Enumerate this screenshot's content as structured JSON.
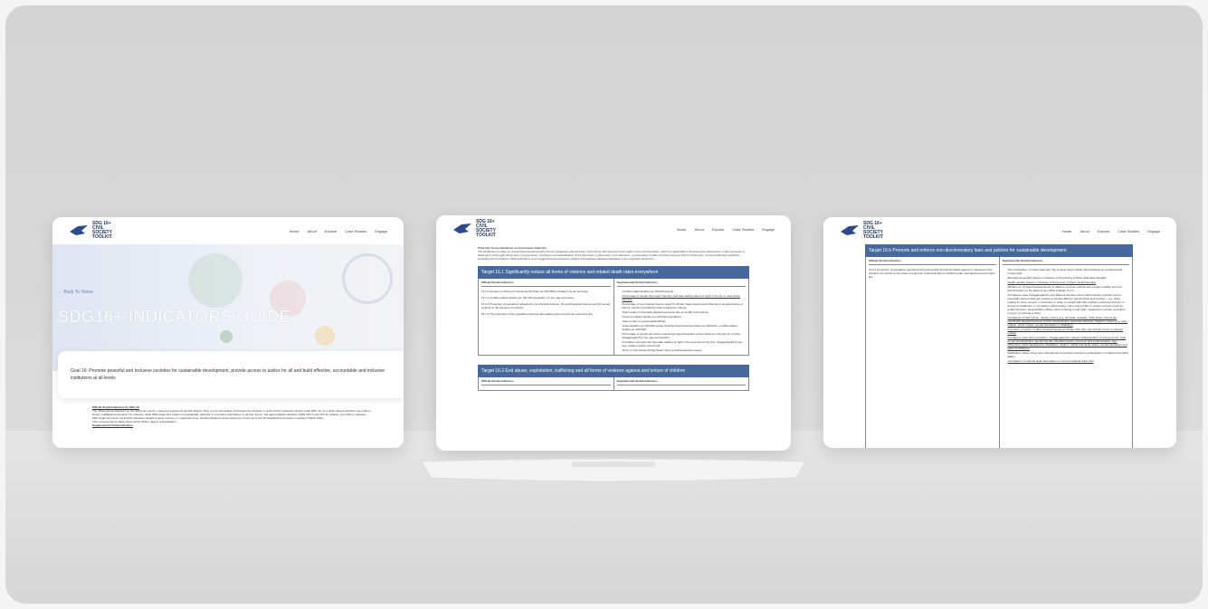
{
  "site": {
    "logo": "SDG 16+ CIVIL SOCIETY TOOLKIT",
    "menu": [
      "Home",
      "About",
      "Explore",
      "Case Studies",
      "Engage"
    ]
  },
  "screen1": {
    "back": "← Back To Home",
    "title": "SDG16+ INDICATORS GUIDE",
    "goal": "Goal 16: Promote peaceful and inclusive societies for sustainable development, provide access to justice for all and build effective, accountable and inclusive institutions at all levels",
    "section": "Official Global Indicators for SDG 16",
    "body": "The official global indicators for the SDGs are used to measure progress on specific targets. They do not necessarily encompass the full letter or spirit of their respective targets under SDG 16, as a given target's ambition may refer to broad, multifaceted concepts. For instance, while SDG target 16.1 refers to a sustainable reduction in corruption and bribery \"in all their forms\", the agreed global indicators (SDG 16.5.1 and 16.5.2) measure only bribery. Likewise, SDG target 16.4 does not include indicators related to asset recovery or organized crime. Global indicators shown below are current as of the UN Statistical Commission meeting in March 2021.",
    "note": "This correspondence table shows all the SDGs, targets and indicators.",
    "supp": "Supplemental Global Indicators"
  },
  "screen2": {
    "intro_title": "Praia City Group Handbook on Governance Statistics",
    "intro": "The Handbook provides an overarching framework with common analytical underpinnings, informed by international human rights norms and principles, which are applicable to all governance dimensions. It also examines in detail each of the eight dimensions of governance, including a conceptualization of the dimension, a discussion of its relevance, a presentation of data and best practices that currently exist, recommended key indicators (including but not limited to SDG indicators), and a suggested way forward to achieve international statistical standards in the respective dimension.",
    "t1_title": "Target 16.1 Significantly reduce all forms of violence and related death rates everywhere",
    "col_official": "Official Global Indicators",
    "col_supp": "Supplemental Global Indicators",
    "t1_official": [
      "16.1.1 Number of victims of intentional homicide per 100,000 population, by sex and age",
      "16.1.2 Conflict-related deaths per 100,000 population, by sex, age and cause",
      "16.1.3 Proportion of population subjected to (a) physical violence, (b) psychological violence and (c) sexual violence in the previous 12 months",
      "16.1.4 The proportion of the population that feel safe walking alone around the area they live"
    ],
    "t1_supp": [
      "Conflict-related deaths per 100,000 people",
      "Percentage of people who report that they feel safe walking alone at night in the city or area where they live",
      "Percentage of ever-married women aged 15-49 who have experienced physical or sexual violence in last 12 months committed by their husband or partner",
      "Total number of internally displaced persons due to conflict and violence",
      "Firearms related injuries per 100,000 populations",
      "Total number of extra-judicial killings",
      "Violent deaths per 100,000 people (includes intentional homicides per 100,000 + conflict-related deaths per 100,000)",
      "Percentage of people who have experienced physical and/or sexual violence in the last 12 months, disaggregated by sex, age and location",
      "Proportion of people who feel safe walking at night in the area where they live, disaggregated by sex, age, location and/or urban/rural",
      "Score on the annual Global Peace Index (positive/negative peace)"
    ],
    "t2_title": "Target 16.2 End abuse, exploitation, trafficking and all forms of violence against and torture of children"
  },
  "screen3": {
    "t_title": "Target 16.b Promote and enforce non-discriminatory laws and policies for sustainable development",
    "col_official": "Official Global Indicators",
    "col_supp": "Supplemental Global Indicators",
    "official": "16.b.1 Proportion of population reporting having personally felt discriminated against or harassed in the previous 12 months on the basis of a ground of discrimination prohibited under international human rights law",
    "supp": [
      "The Constitution, or other basic law, has a clause that prohibits discrimination as a fundamental human right",
      "Educational equality based on Varieties of Democracy (V-Dem) Education Equality",
      "Health equality based on Varieties of Democracy (V-Dem) Health Equality",
      "Whether or not legal frameworks are in place to promote, enforce and monitor equality and non-discrimination on the basis of sex (SDG indicator 5.1.1)",
      "Prevalence rates, disaggregated by the different domains where discrimination typically occurs, especially when people are seeking to access different opportunities and services – e.g. when looking for work, at work, in education or when in contact with their children's school personnel, in access to healthcare, in connection with housing, when using public or private services (such as public transport, administrative offices, when entering a night club, restaurant or a hotel, and when trying in or entering a shop)",
      "Prevalence of hate crimes, namely crimes (e.g. homicide, assaults, theft) where victims are specifically targeted because of their characteristics (ascribed attributes, beliefs or values (e.g. race, religion, ethnic origins, sexual orientation or disability))",
      "Proportion of victims of discrimination/harassment/hate crime who reported the crime to relevant entities",
      "Prevalence rates and proportions, disaggregated by relevant characteristics of groups at risk, such as sex characteristics, gender identity, education levels, economic and social situation, age, citizenship, ethnic background, disabilities, religion, marital and family status, sexual orientation and place of residence",
      "Ratification status of five core international conventions relevant to participation in political and public affairs",
      "Compliance of national legal frameworks on civil and political rights with"
    ]
  }
}
